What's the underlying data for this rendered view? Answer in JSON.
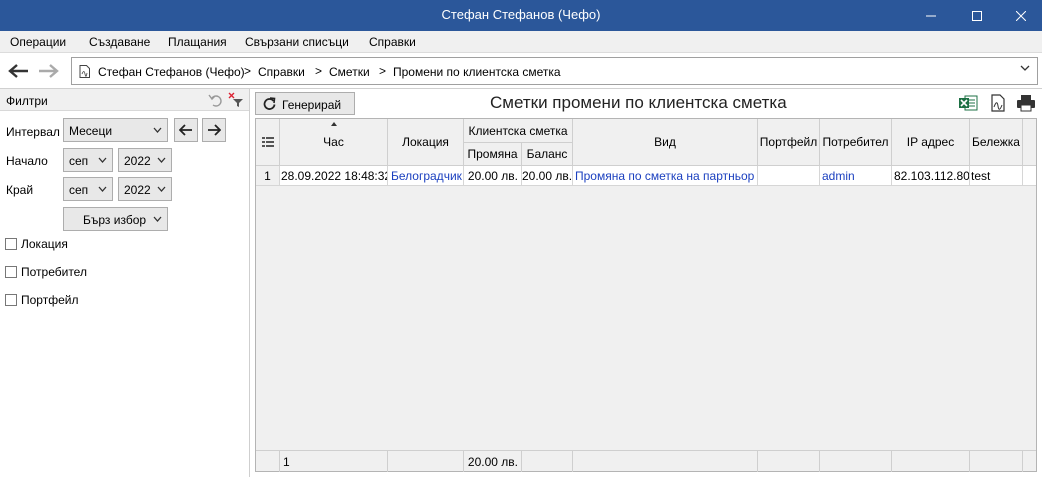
{
  "window": {
    "title": "Стефан Стефанов (Чефо)"
  },
  "menu": [
    "Операции",
    "Създаване",
    "Плащания",
    "Свързани списъци",
    "Справки"
  ],
  "breadcrumb": [
    "Стефан Стефанов (Чефо)",
    "Справки",
    "Сметки",
    "Промени по клиентска сметка"
  ],
  "breadcrumb_sep": ">",
  "filters": {
    "header": "Филтри",
    "interval_label": "Интервал",
    "interval_value": "Месеци",
    "start_label": "Начало",
    "start_month": "сеп",
    "start_year": "2022",
    "end_label": "Край",
    "end_month": "сеп",
    "end_year": "2022",
    "quick_select": "Бърз избор",
    "checkboxes": [
      "Локация",
      "Потребител",
      "Портфейл"
    ]
  },
  "toolbar": {
    "generate_label": "Генерирай"
  },
  "report": {
    "title": "Сметки промени по клиентска сметка"
  },
  "table": {
    "headers": {
      "time": "Час",
      "location": "Локация",
      "client_account": "Клиентска сметка",
      "change": "Промяна",
      "balance": "Баланс",
      "type": "Вид",
      "wallet": "Портфейл",
      "user": "Потребител",
      "ip": "IP адрес",
      "note": "Бележка"
    },
    "rows": [
      {
        "num": "1",
        "time": "28.09.2022 18:48:32",
        "location": "Белоградчик",
        "change": "20.00 лв.",
        "balance": "20.00 лв.",
        "type": "Промяна по сметка на партньор",
        "wallet": "",
        "user": "admin",
        "ip": "82.103.112.80",
        "note": "test"
      }
    ],
    "footer": {
      "count": "1",
      "change_total": "20.00 лв."
    }
  },
  "colors": {
    "titlebar": "#2b579a",
    "link": "#1a3fbf",
    "excel": "#1d7044"
  }
}
